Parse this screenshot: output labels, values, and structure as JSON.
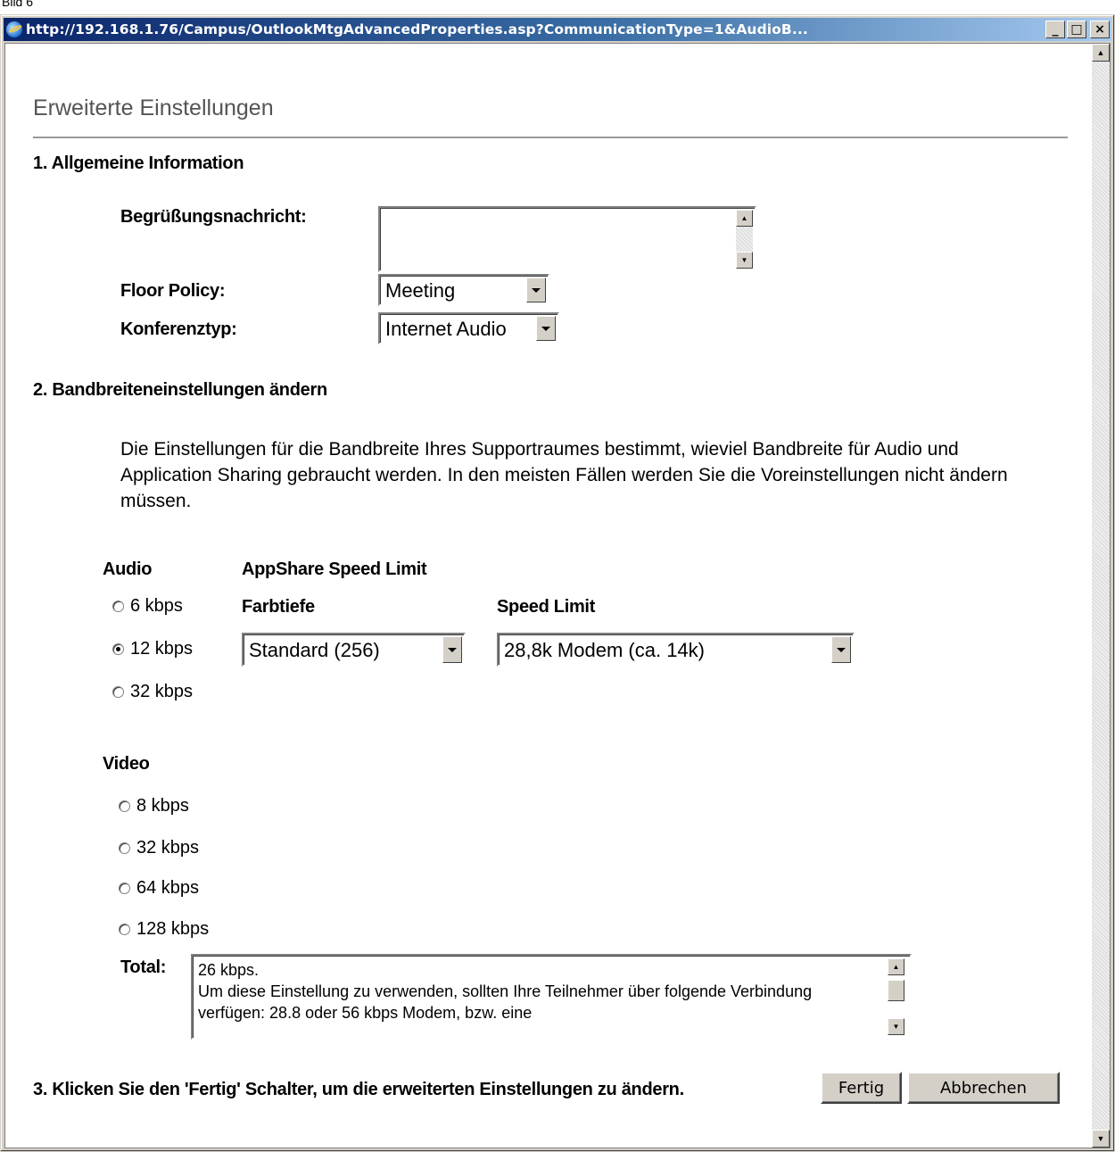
{
  "caption": "Bild 6",
  "window": {
    "title": "http://192.168.1.76/Campus/OutlookMtgAdvancedProperties.asp?CommunicationType=1&AudioB...",
    "controls": {
      "minimize": "_",
      "maximize": "□",
      "close": "×"
    }
  },
  "page": {
    "heading": "Erweiterte Einstellungen",
    "section1": {
      "title": "1.  Allgemeine Information",
      "greeting_label": "Begrüßungsnachricht:",
      "greeting_value": "",
      "floor_policy_label": "Floor Policy:",
      "floor_policy_value": "Meeting",
      "conference_type_label": "Konferenztyp:",
      "conference_type_value": "Internet Audio"
    },
    "section2": {
      "title": "2.  Bandbreiteneinstellungen ändern",
      "description": "Die Einstellungen für die Bandbreite Ihres Supportraumes bestimmt, wieviel Bandbreite für Audio und Application Sharing gebraucht werden. In den meisten Fällen werden Sie die Voreinstellungen nicht ändern müssen.",
      "audio_label": "Audio",
      "audio_options": [
        {
          "label": "6 kbps",
          "checked": false
        },
        {
          "label": "12 kbps",
          "checked": true
        },
        {
          "label": "32 kbps",
          "checked": false
        }
      ],
      "appshare_label": "AppShare Speed Limit",
      "color_depth_label": "Farbtiefe",
      "color_depth_value": "Standard (256)",
      "speed_limit_label": "Speed Limit",
      "speed_limit_value": "28,8k Modem (ca. 14k)",
      "video_label": "Video",
      "video_options": [
        {
          "label": "8 kbps",
          "checked": false
        },
        {
          "label": "32 kbps",
          "checked": false
        },
        {
          "label": "64 kbps",
          "checked": false
        },
        {
          "label": "128 kbps",
          "checked": false
        }
      ],
      "total_label": "Total:",
      "total_text": "26 kbps.\nUm diese Einstellung zu verwenden, sollten Ihre Teilnehmer über folgende Verbindung verfügen: 28.8 oder 56 kbps Modem, bzw. eine"
    },
    "section3": {
      "title": "3. Klicken Sie den 'Fertig' Schalter, um die erweiterten Einstellungen zu ändern.",
      "done_button": "Fertig",
      "cancel_button": "Abbrechen"
    }
  }
}
